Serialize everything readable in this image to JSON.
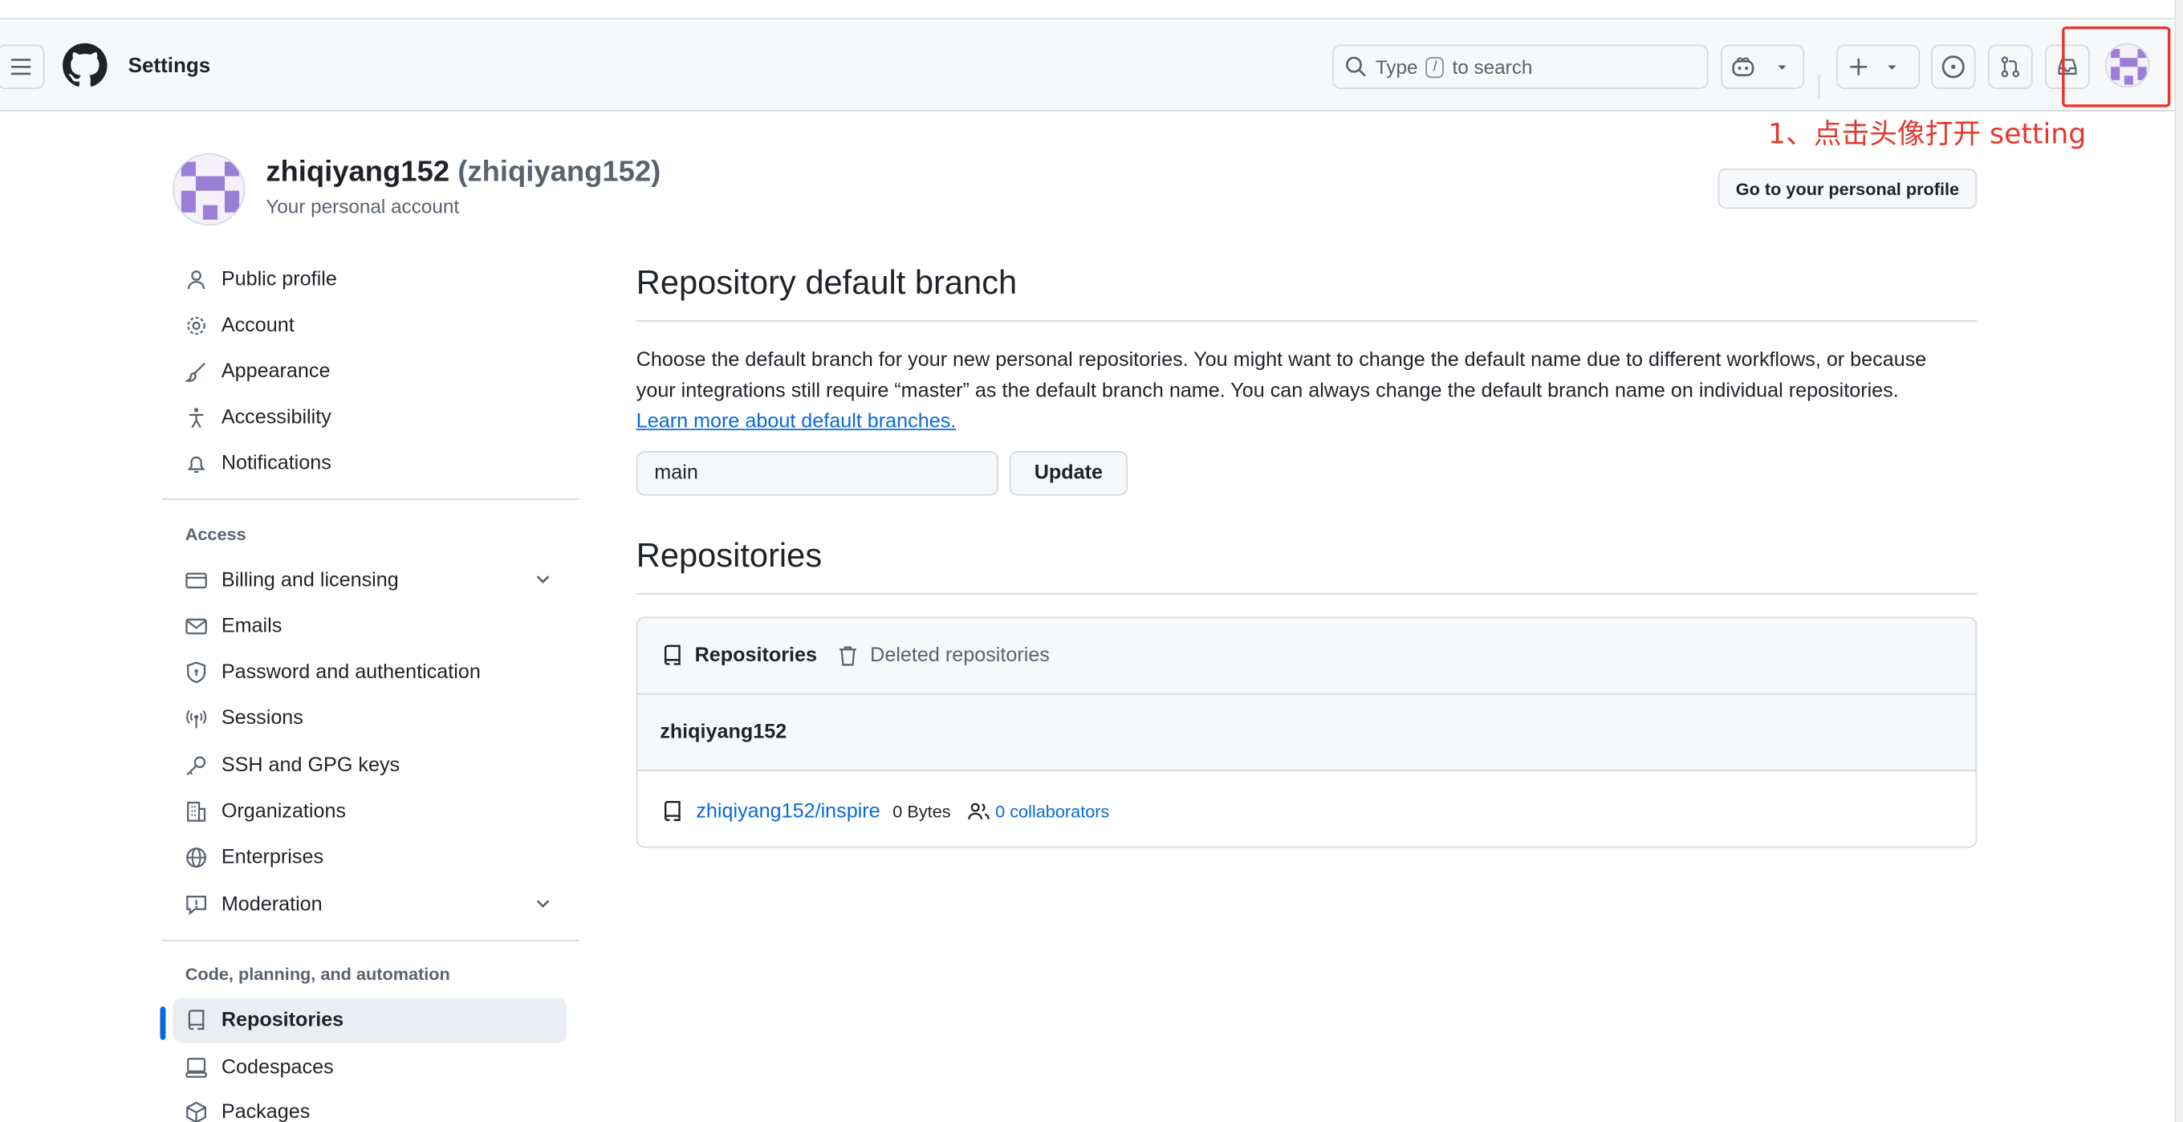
{
  "header": {
    "title": "Settings",
    "search_prefix": "Type",
    "search_key": "/",
    "search_suffix": "to search"
  },
  "annotation": {
    "text": "1、点击头像打开 setting",
    "color": "#e5382d"
  },
  "user": {
    "name": "zhiqiyang152",
    "login": "(zhiqiyang152)",
    "subtitle": "Your personal account",
    "profile_button": "Go to your personal profile"
  },
  "sidebar": {
    "items": [
      {
        "label": "Public profile",
        "icon": "person-icon"
      },
      {
        "label": "Account",
        "icon": "gear-icon"
      },
      {
        "label": "Appearance",
        "icon": "paintbrush-icon"
      },
      {
        "label": "Accessibility",
        "icon": "accessibility-icon"
      },
      {
        "label": "Notifications",
        "icon": "bell-icon"
      }
    ],
    "access_heading": "Access",
    "access_items": [
      {
        "label": "Billing and licensing",
        "icon": "credit-card-icon"
      },
      {
        "label": "Emails",
        "icon": "mail-icon"
      },
      {
        "label": "Password and authentication",
        "icon": "shield-lock-icon"
      },
      {
        "label": "Sessions",
        "icon": "broadcast-icon"
      },
      {
        "label": "SSH and GPG keys",
        "icon": "key-icon"
      },
      {
        "label": "Organizations",
        "icon": "organization-icon"
      },
      {
        "label": "Enterprises",
        "icon": "globe-icon"
      },
      {
        "label": "Moderation",
        "icon": "report-icon"
      }
    ],
    "code_heading": "Code, planning, and automation",
    "code_items": [
      {
        "label": "Repositories",
        "icon": "repo-icon",
        "active": true
      },
      {
        "label": "Codespaces",
        "icon": "codespaces-icon"
      },
      {
        "label": "Packages",
        "icon": "package-icon"
      }
    ]
  },
  "main": {
    "default_branch_heading": "Repository default branch",
    "default_branch_text": "Choose the default branch for your new personal repositories. You might want to change the default name due to different workflows, or because your integrations still require “master” as the default branch name. You can always change the default branch name on individual repositories.",
    "default_branch_link": "Learn more about default branches.",
    "branch_value": "main",
    "update_label": "Update",
    "repositories_heading": "Repositories",
    "tabs": [
      {
        "label": "Repositories",
        "icon": "repo-icon",
        "selected": true
      },
      {
        "label": "Deleted repositories",
        "icon": "trash-icon",
        "selected": false
      }
    ],
    "owner": "zhiqiyang152",
    "repos": [
      {
        "name": "zhiqiyang152/inspire",
        "size": "0 Bytes",
        "collaborators": "0 collaborators"
      }
    ]
  },
  "colors": {
    "accent": "#0969da",
    "annotation_red": "#e5382d",
    "avatar_purple": "#9b7ed6"
  }
}
